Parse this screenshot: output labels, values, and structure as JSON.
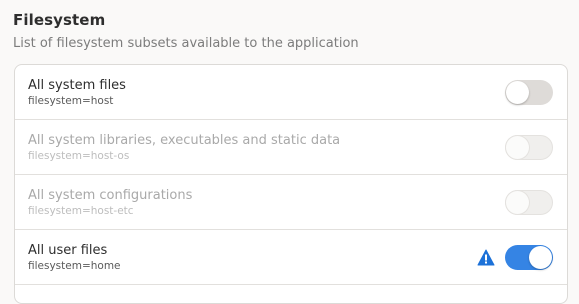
{
  "section": {
    "title": "Filesystem",
    "description": "List of filesystem subsets available to the application"
  },
  "rows": [
    {
      "title": "All system files",
      "subtitle": "filesystem=host",
      "enabled": true,
      "on": false,
      "warning": false
    },
    {
      "title": "All system libraries, executables and static data",
      "subtitle": "filesystem=host-os",
      "enabled": false,
      "on": false,
      "warning": false
    },
    {
      "title": "All system configurations",
      "subtitle": "filesystem=host-etc",
      "enabled": false,
      "on": false,
      "warning": false
    },
    {
      "title": "All user files",
      "subtitle": "filesystem=home",
      "enabled": true,
      "on": true,
      "warning": true
    }
  ],
  "icons": {
    "warning": "warning-triangle-icon"
  },
  "colors": {
    "accent": "#3584e4",
    "warning_icon": "#1c71d8"
  }
}
